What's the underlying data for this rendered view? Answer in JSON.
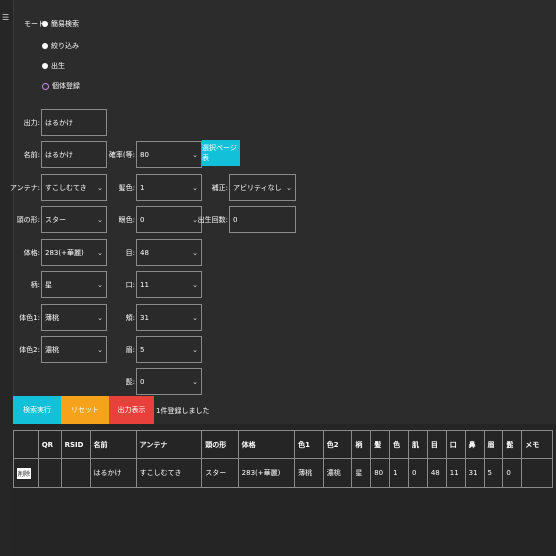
{
  "sidebar_icon": "menu-icon",
  "mode": {
    "label": "モード:",
    "options": [
      {
        "label": "簡易検索",
        "selected": false
      },
      {
        "label": "絞り込み",
        "selected": false
      },
      {
        "label": "出生",
        "selected": false
      },
      {
        "label": "個体登録",
        "selected": true
      }
    ]
  },
  "form": {
    "output_label": "出力:",
    "output_value": "はるかけ",
    "name_label": "名前:",
    "name_value": "はるかけ",
    "antenna_label": "アンテナ:",
    "antenna_value": "すこしむてき",
    "head_label": "頭の形:",
    "head_value": "スター",
    "body_label": "体格:",
    "body_value": "283(+華麗)",
    "pattern_label": "柄:",
    "pattern_value": "星",
    "color1_label": "体色1:",
    "color1_value": "薄桃",
    "color2_label": "体色2:",
    "color2_value": "濃桃",
    "ritsu_label": "確率(等:",
    "ritsu_value": "80",
    "hair_label": "髪色:",
    "hair_value": "1",
    "eye_color_label": "眼色:",
    "eye_color_value": "0",
    "eye_label": "目:",
    "eye_value": "48",
    "mouth_label": "口:",
    "mouth_value": "11",
    "cheek_label": "頬:",
    "cheek_value": "31",
    "brow_label": "眉:",
    "brow_value": "5",
    "whisker_label": "髭:",
    "whisker_value": "0",
    "sheet_button": "選択ページ表",
    "note_label": "補正:",
    "note_value": "アビリティなし",
    "birth_label": "出生回数:",
    "birth_value": "0"
  },
  "actions": {
    "search": "検索実行",
    "reset": "リセット",
    "export": "出力表示",
    "status": "1件登録しました"
  },
  "table": {
    "headers": [
      "",
      "QR",
      "RSID",
      "名前",
      "アンテナ",
      "頭の形",
      "体格",
      "色1",
      "色2",
      "柄",
      "髪",
      "色",
      "肌",
      "目",
      "口",
      "鼻",
      "眉",
      "髭",
      "メモ"
    ],
    "rows": [
      [
        "削除",
        "",
        "",
        "はるかけ",
        "すこしむてき",
        "スター",
        "283(+華麗)",
        "薄桃",
        "濃桃",
        "星",
        "80",
        "1",
        "0",
        "48",
        "11",
        "31",
        "5",
        "0",
        ""
      ]
    ]
  }
}
